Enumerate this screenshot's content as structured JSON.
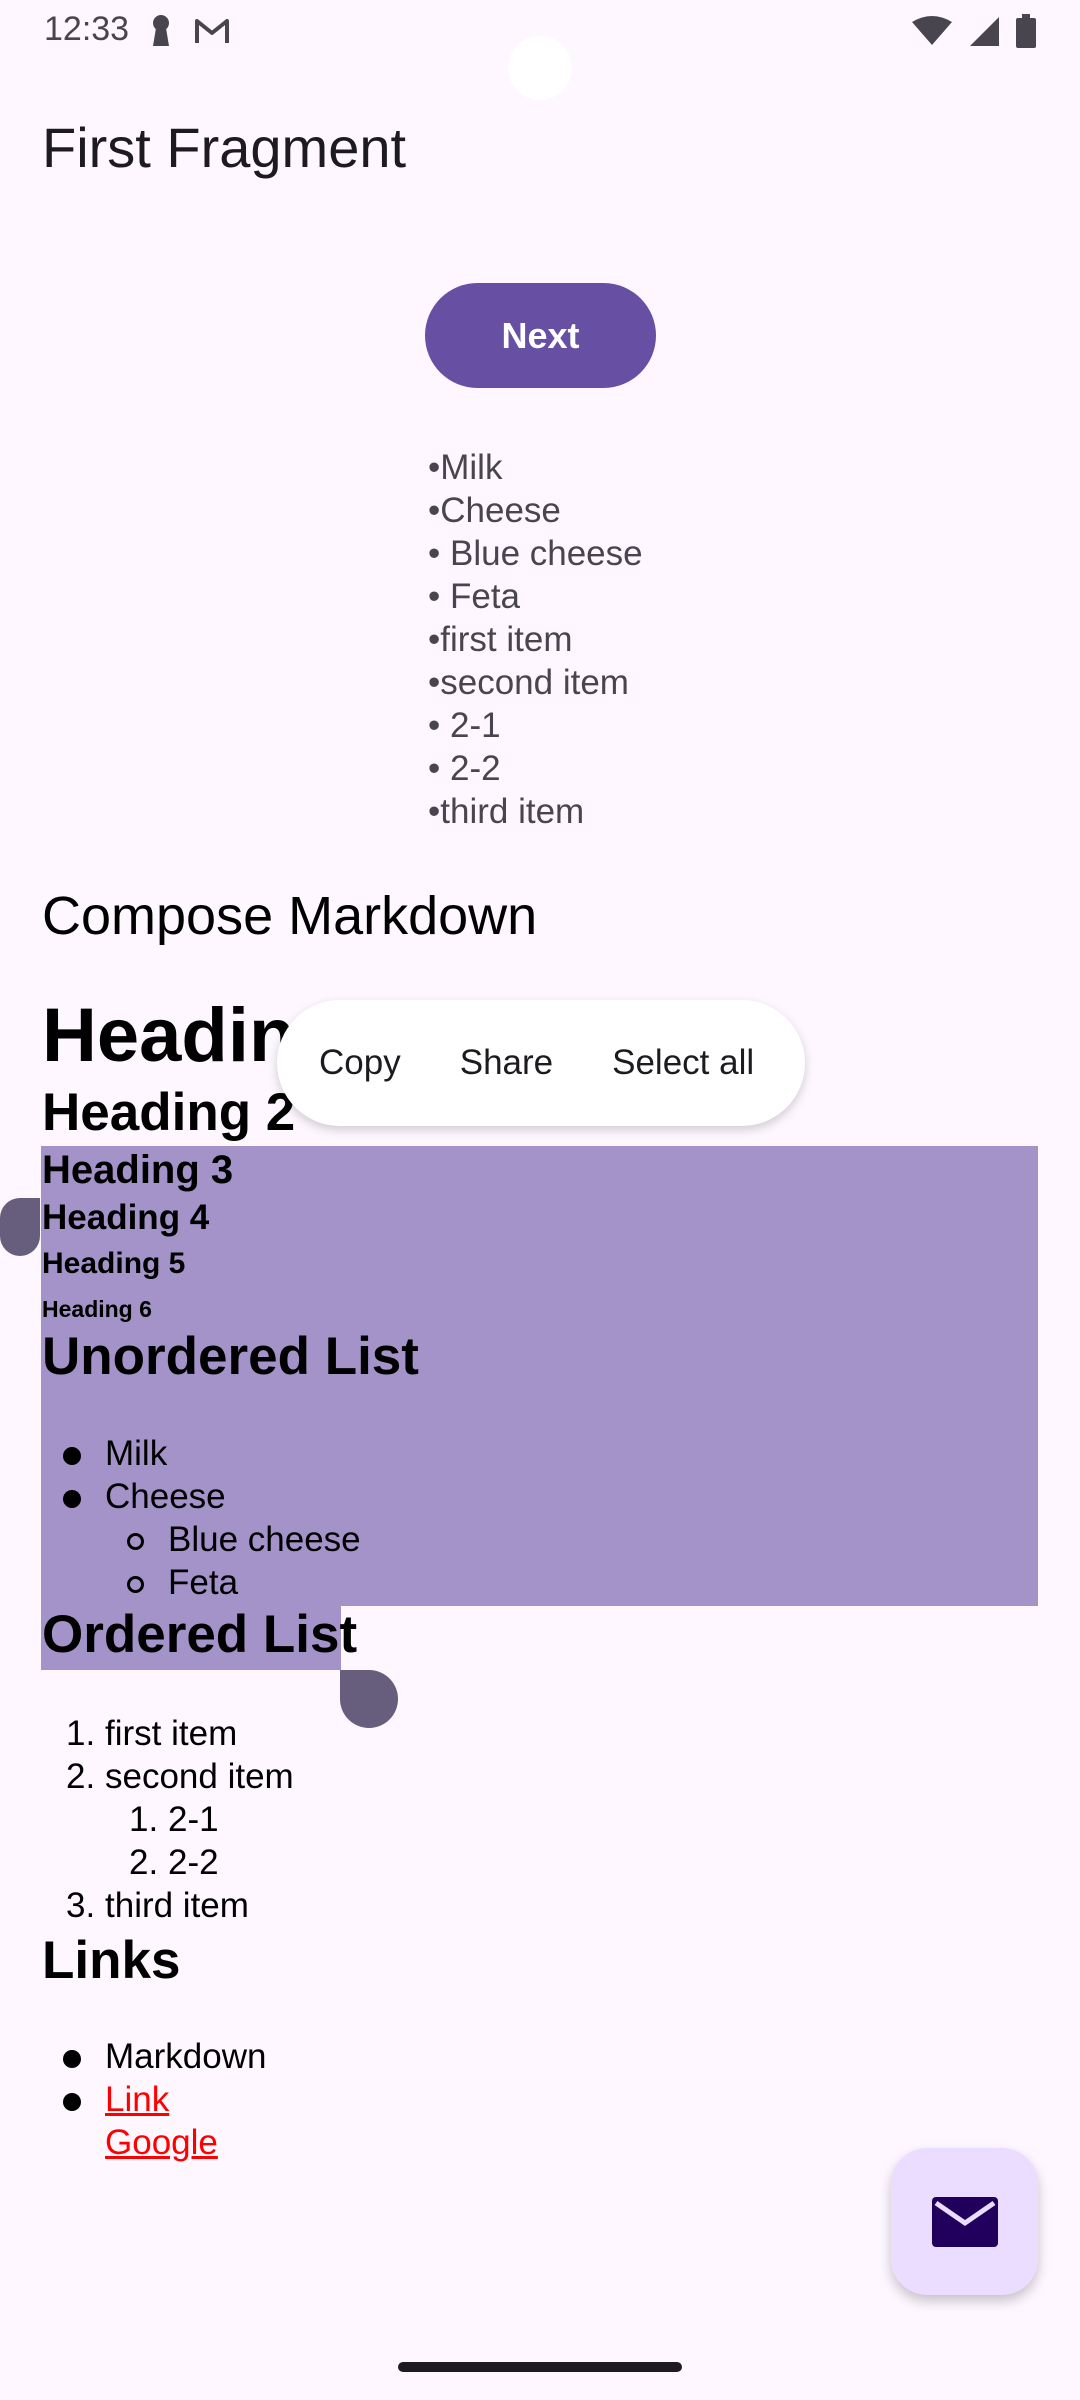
{
  "status_bar": {
    "time": "12:33",
    "left_icons": [
      "keyhole-icon",
      "gmail-icon"
    ],
    "right_icons": [
      "wifi-icon",
      "signal-icon",
      "battery-icon"
    ]
  },
  "app_bar": {
    "title": "First Fragment"
  },
  "next_button": {
    "label": "Next"
  },
  "plain_list": [
    "•Milk",
    "•Cheese",
    "• Blue cheese",
    "• Feta",
    "•first item",
    "•second item",
    "• 2-1",
    "• 2-2",
    "•third item"
  ],
  "compose": {
    "title": "Compose Markdown",
    "headings": [
      "Heading",
      "Heading 2",
      "Heading 3",
      "Heading 4",
      "Heading 5",
      "Heading 6"
    ],
    "unordered": {
      "title": "Unordered List",
      "items": [
        "Milk",
        "Cheese"
      ],
      "sub_items": [
        "Blue cheese",
        "Feta"
      ]
    },
    "ordered": {
      "title": "Ordered List",
      "items": [
        {
          "num": "1.",
          "text": "first item"
        },
        {
          "num": "2.",
          "text": "second item"
        },
        {
          "num": "3.",
          "text": "third item"
        }
      ],
      "sub_items": [
        {
          "num": "1.",
          "text": "2-1"
        },
        {
          "num": "2.",
          "text": "2-2"
        }
      ]
    },
    "links": {
      "title": "Links",
      "plain_item": "Markdown",
      "link_items": [
        "Link",
        "Google"
      ],
      "link_color": "#FF0000"
    }
  },
  "context_menu": {
    "copy": "Copy",
    "share": "Share",
    "select_all": "Select all"
  },
  "fab": {
    "icon": "mail-icon"
  },
  "colors": {
    "primary": "#6750A4",
    "selection": "#A393C9",
    "fab_bg": "#EADDFF",
    "background": "#FEF7FF"
  }
}
